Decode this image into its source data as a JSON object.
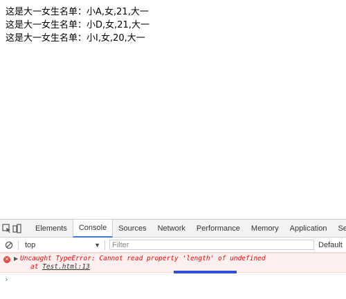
{
  "page": {
    "lines": [
      "这是大一女生名单：小A,女,21,大一",
      "这是大一女生名单：小D,女,21,大一",
      "这是大一女生名单：小I,女,20,大一"
    ]
  },
  "devtools": {
    "tabs": [
      "Elements",
      "Console",
      "Sources",
      "Network",
      "Performance",
      "Memory",
      "Application",
      "Se"
    ],
    "active_tab": "Console",
    "toolbar": {
      "context": "top",
      "filter_placeholder": "Filter",
      "levels": "Default"
    },
    "console": {
      "error_message": "Uncaught TypeError: Cannot read property 'length' of undefined",
      "error_at": "at ",
      "error_source": "Test.html:13",
      "prompt": "›"
    },
    "colors": {
      "active_tab_underline": "#3c78d8",
      "error_text": "#ff0000",
      "error_background": "#fff0f0",
      "annotation_bar": "#2f4fd9"
    }
  }
}
